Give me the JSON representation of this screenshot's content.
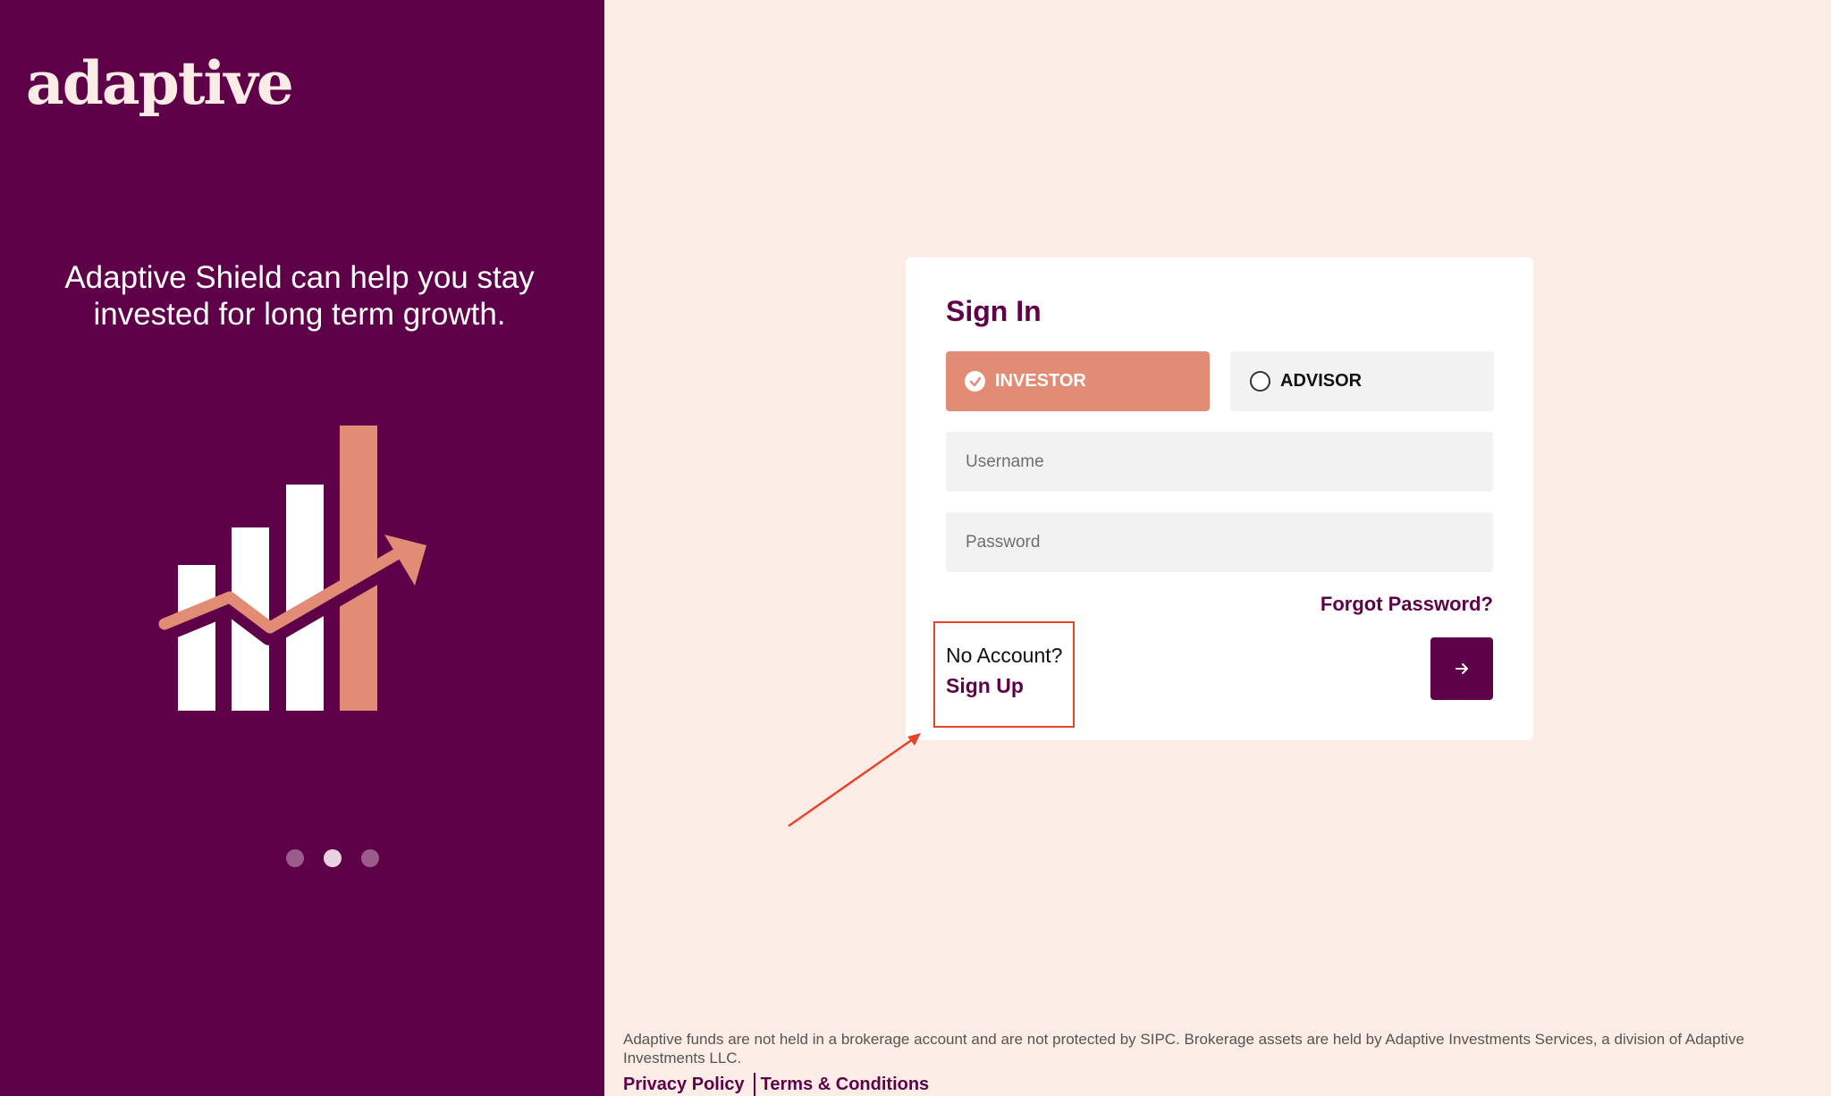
{
  "brand": {
    "logo_text": "adaptive",
    "purple": "#5f0148",
    "salmon": "#e28c76",
    "cream": "#fbece5"
  },
  "hero": {
    "tagline": "Adaptive Shield can help you stay invested for long term growth.",
    "illustration": "bar-chart-growth-arrow-icon",
    "carousel": {
      "count": 3,
      "active_index": 1
    }
  },
  "signin": {
    "title": "Sign In",
    "roles": [
      {
        "label": "INVESTOR",
        "selected": true
      },
      {
        "label": "ADVISOR",
        "selected": false
      }
    ],
    "username_placeholder": "Username",
    "password_placeholder": "Password",
    "forgot_label": "Forgot Password?",
    "no_account_text": "No Account?",
    "signup_label": "Sign Up",
    "submit_icon": "arrow-right-icon"
  },
  "annotation": {
    "color": "#e8442a"
  },
  "footer": {
    "disclaimer": "Adaptive funds are not held in a brokerage account and are not protected by SIPC. Brokerage assets are held by Adaptive Investments Services, a division of Adaptive Investments LLC.",
    "privacy_label": "Privacy Policy",
    "terms_label": "Terms & Conditions"
  }
}
